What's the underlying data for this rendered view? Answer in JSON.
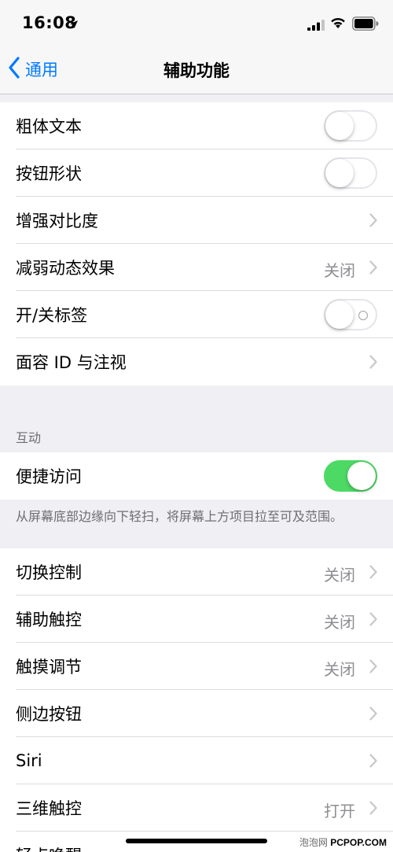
{
  "status": {
    "time": "16:08"
  },
  "nav": {
    "back_label": "通用",
    "title": "辅助功能"
  },
  "group1": [
    {
      "label": "粗体文本",
      "control": "toggle",
      "on": false
    },
    {
      "label": "按钮形状",
      "control": "toggle",
      "on": false
    },
    {
      "label": "增强对比度",
      "control": "chevron"
    },
    {
      "label": "减弱动态效果",
      "control": "chevron",
      "value": "关闭"
    },
    {
      "label": "开/关标签",
      "control": "toggle",
      "on": false,
      "off_label_mark": true
    },
    {
      "label": "面容 ID 与注视",
      "control": "chevron"
    }
  ],
  "interaction": {
    "header": "互动",
    "reachability": {
      "label": "便捷访问",
      "on": true
    },
    "footer": "从屏幕底部边缘向下轻扫，将屏幕上方项目拉至可及范围。"
  },
  "group3": [
    {
      "label": "切换控制",
      "value": "关闭"
    },
    {
      "label": "辅助触控",
      "value": "关闭"
    },
    {
      "label": "触摸调节",
      "value": "关闭"
    },
    {
      "label": "侧边按钮",
      "value": ""
    },
    {
      "label": "Siri",
      "value": ""
    },
    {
      "label": "三维触控",
      "value": "打开"
    },
    {
      "label": "轻点唤醒",
      "value": ""
    }
  ],
  "watermark": {
    "site_cn": "泡泡网",
    "site_en": "PCPOP.COM"
  },
  "colors": {
    "accent": "#007aff",
    "switch_on": "#4cd964",
    "value_gray": "#8e8e93"
  }
}
